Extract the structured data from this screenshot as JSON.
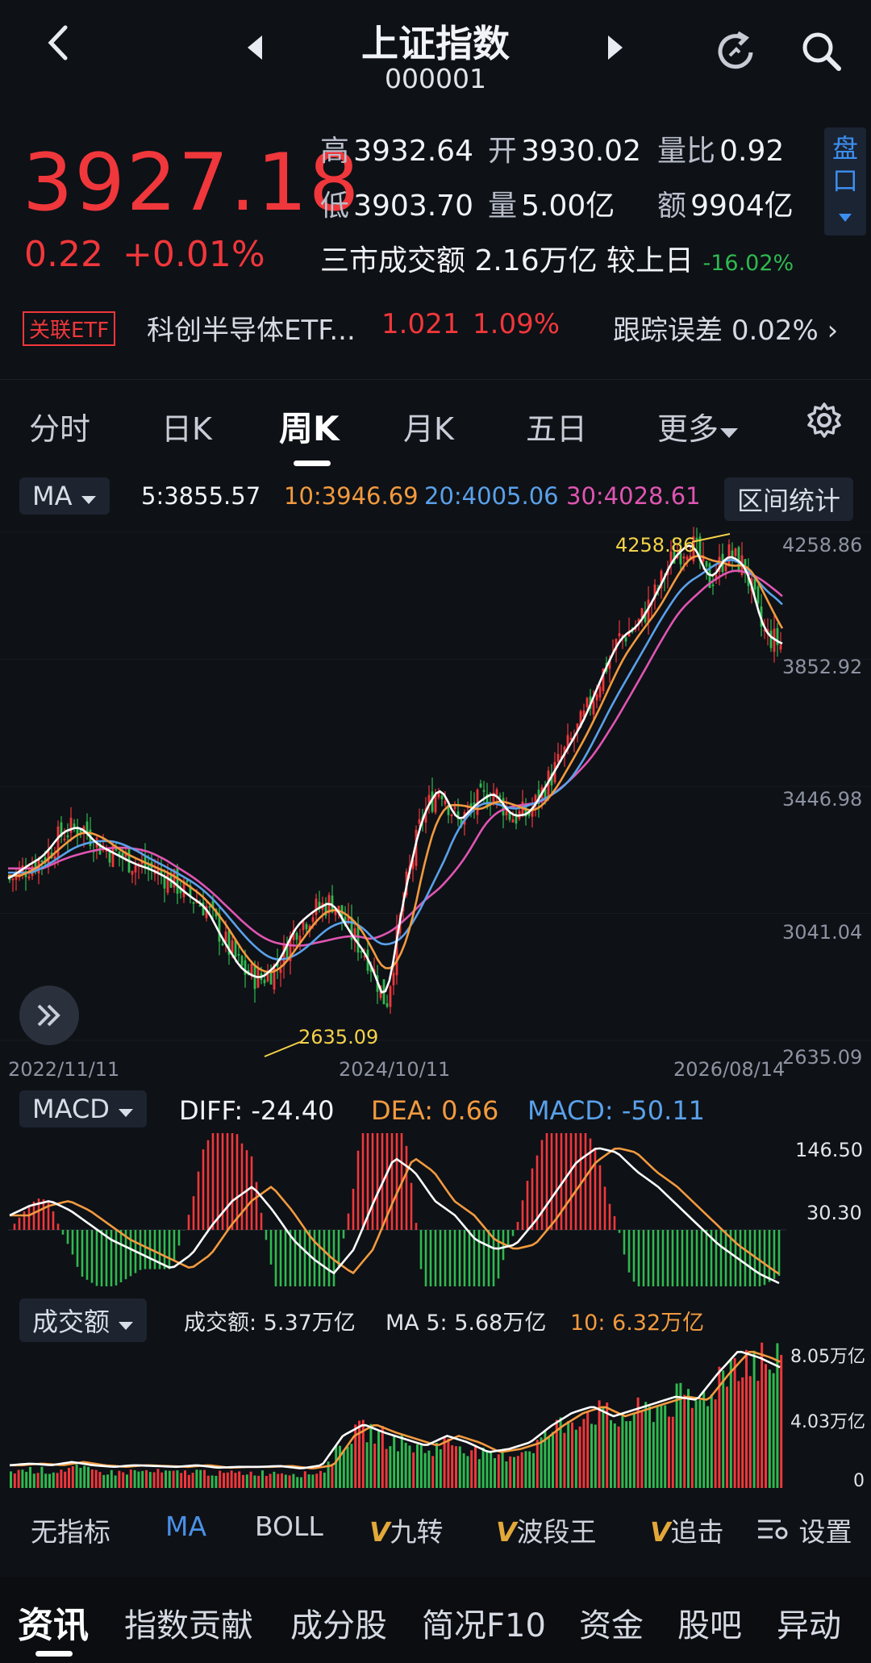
{
  "header": {
    "title": "上证指数",
    "code": "000001"
  },
  "quote": {
    "price": "3927.18",
    "change": "0.22",
    "change_pct": "+0.01%",
    "high_label": "高",
    "high": "3932.64",
    "open_label": "开",
    "open": "3930.02",
    "vol_ratio_label": "量比",
    "vol_ratio": "0.92",
    "low_label": "低",
    "low": "3903.70",
    "volume_label": "量",
    "volume": "5.00亿",
    "amount_label": "额",
    "amount": "9904亿",
    "market_turnover": "三市成交额 2.16万亿 较上日",
    "market_turnover_change": "-16.02%",
    "panel_toggle": "盘口"
  },
  "etf": {
    "tag": "关联ETF",
    "name": "科创半导体ETF...",
    "price": "1.021",
    "pct": "1.09%",
    "tracking_label": "跟踪误差",
    "tracking": "0.02%"
  },
  "tabs": [
    "分时",
    "日K",
    "周K",
    "月K",
    "五日",
    "更多"
  ],
  "active_tab": "周K",
  "ma_bar": {
    "selector": "MA",
    "ma5": "5:3855.57",
    "ma10": "10:3946.69",
    "ma20": "20:4005.06",
    "ma30": "30:4028.61",
    "range_btn": "区间统计"
  },
  "chart_data": {
    "type": "candlestick",
    "y_axis_labels": [
      "4258.86",
      "3852.92",
      "3446.98",
      "3041.04",
      "2635.09"
    ],
    "ylim": [
      2635.09,
      4258.86
    ],
    "x_axis_labels": [
      "2022/11/11",
      "2024/10/11",
      "2026/08/14"
    ],
    "annotations": {
      "max": "4258.86",
      "min": "2635.09"
    },
    "ma5_close": [
      3150,
      3190,
      3225,
      3300,
      3320,
      3260,
      3230,
      3200,
      3180,
      3150,
      3100,
      3060,
      2950,
      2860,
      2830,
      2880,
      3000,
      3050,
      3080,
      2980,
      2900,
      2750,
      3100,
      3350,
      3450,
      3330,
      3390,
      3430,
      3350,
      3360,
      3460,
      3560,
      3660,
      3800,
      3920,
      3960,
      4060,
      4180,
      4230,
      4100,
      4190,
      4150,
      3940,
      3900
    ],
    "colors": {
      "ma5": "#ffffff",
      "ma10": "#f29a3f",
      "ma20": "#5aa1ea",
      "ma30": "#e055b2",
      "up": "#f0373b",
      "down": "#2fb94f"
    }
  },
  "macd": {
    "selector": "MACD",
    "diff": "DIFF: -24.40",
    "dea": "DEA: 0.66",
    "macd": "MACD: -50.11",
    "axis": [
      "146.50",
      "30.30"
    ]
  },
  "volume": {
    "selector": "成交额",
    "amount": "成交额: 5.37万亿",
    "ma5": "MA 5: 5.68万亿",
    "ma10": "10: 6.32万亿",
    "axis": [
      "8.05万亿",
      "4.03万亿",
      "0"
    ]
  },
  "indicators": [
    "无指标",
    "MA",
    "BOLL",
    "九转",
    "波段王",
    "追击",
    "设置"
  ],
  "bottom_nav": [
    "资讯",
    "指数贡献",
    "成分股",
    "简况F10",
    "资金",
    "股吧",
    "异动"
  ]
}
